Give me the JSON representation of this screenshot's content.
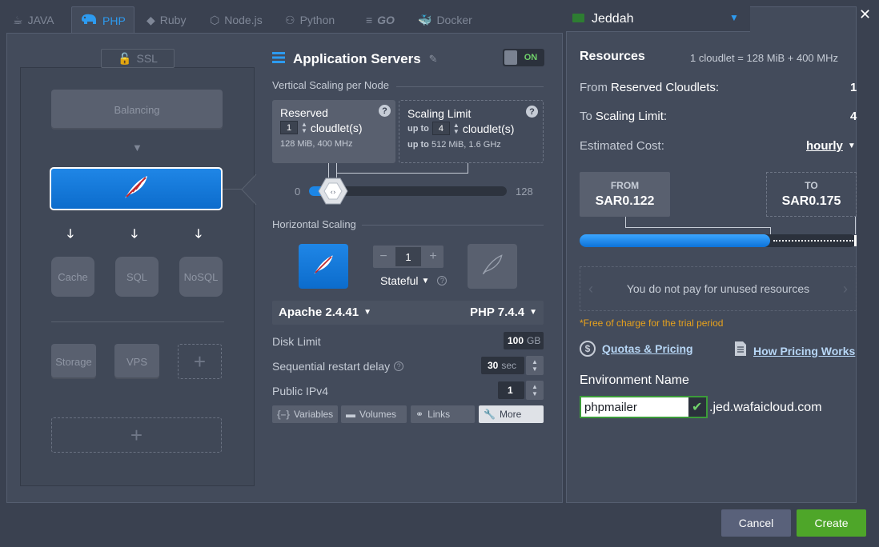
{
  "tabs": [
    {
      "label": "JAVA",
      "icon": "java-icon"
    },
    {
      "label": "PHP",
      "icon": "php-elephant-icon",
      "active": true
    },
    {
      "label": "Ruby",
      "icon": "ruby-icon"
    },
    {
      "label": "Node.js",
      "icon": "nodejs-icon"
    },
    {
      "label": "Python",
      "icon": "python-icon"
    },
    {
      "label": "GO",
      "icon": "go-gopher-icon"
    },
    {
      "label": "Docker",
      "icon": "docker-whale-icon"
    }
  ],
  "topology": {
    "ssl_label": "SSL",
    "balancing_label": "Balancing",
    "cache_label": "Cache",
    "sql_label": "SQL",
    "nosql_label": "NoSQL",
    "storage_label": "Storage",
    "vps_label": "VPS"
  },
  "app_servers": {
    "title": "Application Servers",
    "toggle": "ON",
    "vertical_title": "Vertical Scaling per Node",
    "reserved": {
      "title": "Reserved",
      "value": "1",
      "unit": "cloudlet(s)",
      "spec": "128 MiB, 400 MHz"
    },
    "scaling_limit": {
      "title": "Scaling Limit",
      "up_to": "up to",
      "value": "4",
      "unit": "cloudlet(s)",
      "spec_prefix": "up to",
      "spec": "512 MiB, 1.6 GHz"
    },
    "help": "?",
    "slider": {
      "min": "0",
      "max": "128",
      "reserved_value": 1,
      "limit_value": 4
    },
    "horizontal_title": "Horizontal Scaling",
    "node_count": "1",
    "mode": "Stateful",
    "apache_version": "Apache 2.4.41",
    "php_version": "PHP 7.4.4",
    "disk_limit_label": "Disk Limit",
    "disk_limit_value": "100",
    "disk_limit_unit": "GB",
    "restart_delay_label": "Sequential restart delay",
    "restart_delay_value": "30",
    "restart_delay_unit": "sec",
    "ipv4_label": "Public IPv4",
    "ipv4_value": "1",
    "buttons": {
      "variables": "Variables",
      "volumes": "Volumes",
      "links": "Links",
      "more": "More"
    }
  },
  "region": {
    "name": "Jeddah",
    "flag": "saudi-flag-icon"
  },
  "resources": {
    "title": "Resources",
    "cloudlet_def": "1 cloudlet = 128 MiB + 400 MHz",
    "from_prefix": "From",
    "from_label": "Reserved Cloudlets:",
    "from_value": "1",
    "to_prefix": "To",
    "to_label": "Scaling Limit:",
    "to_value": "4",
    "cost_label": "Estimated Cost:",
    "cost_period": "hourly",
    "price_from_label": "FROM",
    "price_from": "SAR0.122",
    "price_to_label": "TO",
    "price_to": "SAR0.175",
    "carousel_text": "You do not pay for unused resources",
    "trial_note": "*Free of charge for the trial period",
    "quotas_link": "Quotas & Pricing",
    "how_pricing_link": "How Pricing Works"
  },
  "environment": {
    "label": "Environment Name",
    "name": "phpmailer",
    "domain": ".jed.wafaicloud.com"
  },
  "footer": {
    "cancel": "Cancel",
    "create": "Create"
  },
  "colors": {
    "accent": "#1c86e6",
    "create": "#4ea629",
    "on": "#6fd16a",
    "trial": "#e8a21c"
  }
}
